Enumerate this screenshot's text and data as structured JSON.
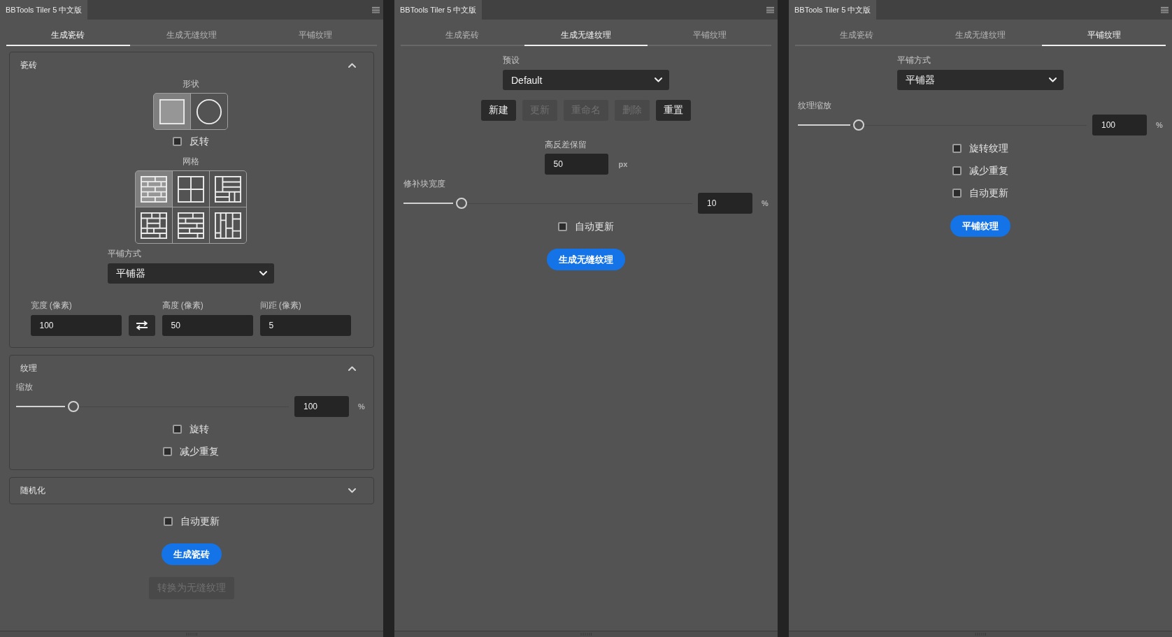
{
  "panels": [
    {
      "title": "BBTools Tiler 5 中文版",
      "tabs": [
        {
          "label": "生成瓷砖",
          "selected": true
        },
        {
          "label": "生成无缝纹理",
          "selected": false
        },
        {
          "label": "平铺纹理",
          "selected": false
        }
      ],
      "items": [
        {
          "kind": "section",
          "title": "瓷砖",
          "expanded": true,
          "items": [
            {
              "kind": "picker",
              "label": "形状",
              "options": [
                {
                  "kind": "square",
                  "selected": true
                },
                {
                  "kind": "circle",
                  "selected": false
                }
              ]
            },
            {
              "kind": "checkbox",
              "label": "反转",
              "checked": false
            },
            {
              "kind": "picker",
              "label": "网格",
              "options": [
                {
                  "kind": "brick",
                  "selected": true
                },
                {
                  "kind": "quarters",
                  "selected": false
                },
                {
                  "kind": "mixed",
                  "selected": false
                },
                {
                  "kind": "basket",
                  "selected": false
                },
                {
                  "kind": "staggered",
                  "selected": false
                },
                {
                  "kind": "columns",
                  "selected": false
                }
              ]
            },
            {
              "kind": "dropdown",
              "label": "平铺方式",
              "value": "平铺器"
            },
            {
              "kind": "size_fields",
              "fields": [
                {
                  "label": "宽度 (像素)",
                  "value": "100"
                },
                {
                  "label": "高度 (像素)",
                  "value": "50"
                },
                {
                  "label": "间距 (像素)",
                  "value": "5"
                }
              ]
            }
          ]
        },
        {
          "kind": "section",
          "title": "纹理",
          "expanded": true,
          "items": [
            {
              "kind": "slider",
              "label": "缩放",
              "level": 0.21,
              "value": "100",
              "unit": "%"
            },
            {
              "kind": "checkbox",
              "label": "旋转",
              "checked": false
            },
            {
              "kind": "checkbox",
              "label": "减少重复",
              "checked": false
            }
          ]
        },
        {
          "kind": "section",
          "title": "随机化",
          "expanded": false
        },
        {
          "kind": "checkbox",
          "label": "自动更新",
          "checked": false
        },
        {
          "kind": "button",
          "label": "生成瓷砖",
          "primary": true,
          "disabled": false
        },
        {
          "kind": "button",
          "label": "转换为无缝纹理",
          "primary": false,
          "disabled": true
        }
      ]
    },
    {
      "title": "BBTools Tiler 5 中文版",
      "tabs": [
        {
          "label": "生成瓷砖",
          "selected": false
        },
        {
          "label": "生成无缝纹理",
          "selected": true
        },
        {
          "label": "平铺纹理",
          "selected": false
        }
      ],
      "items": [
        {
          "kind": "dropdown",
          "label": "预设",
          "value": "Default"
        },
        {
          "kind": "button_row",
          "buttons": [
            {
              "label": "新建",
              "disabled": false
            },
            {
              "label": "更新",
              "disabled": true
            },
            {
              "label": "重命名",
              "disabled": true
            },
            {
              "label": "删除",
              "disabled": true
            },
            {
              "label": "重置",
              "disabled": false
            }
          ]
        },
        {
          "kind": "field",
          "label": "高反差保留",
          "value": "50",
          "unit": "px"
        },
        {
          "kind": "slider",
          "label": "修补块宽度",
          "level": 0.2,
          "value": "10",
          "unit": "%"
        },
        {
          "kind": "checkbox",
          "label": "自动更新",
          "checked": false
        },
        {
          "kind": "button",
          "label": "生成无缝纹理",
          "primary": true,
          "disabled": false
        }
      ]
    },
    {
      "title": "BBTools Tiler 5 中文版",
      "tabs": [
        {
          "label": "生成瓷砖",
          "selected": false
        },
        {
          "label": "生成无缝纹理",
          "selected": false
        },
        {
          "label": "平铺纹理",
          "selected": true
        }
      ],
      "items": [
        {
          "kind": "dropdown",
          "label": "平铺方式",
          "value": "平铺器"
        },
        {
          "kind": "slider",
          "label": "纹理缩放",
          "level": 0.21,
          "value": "100",
          "unit": "%"
        },
        {
          "kind": "checkbox",
          "label": "旋转纹理",
          "checked": false
        },
        {
          "kind": "checkbox",
          "label": "减少重复",
          "checked": false
        },
        {
          "kind": "checkbox",
          "label": "自动更新",
          "checked": false
        },
        {
          "kind": "button",
          "label": "平铺纹理",
          "primary": true,
          "disabled": false
        }
      ]
    }
  ]
}
